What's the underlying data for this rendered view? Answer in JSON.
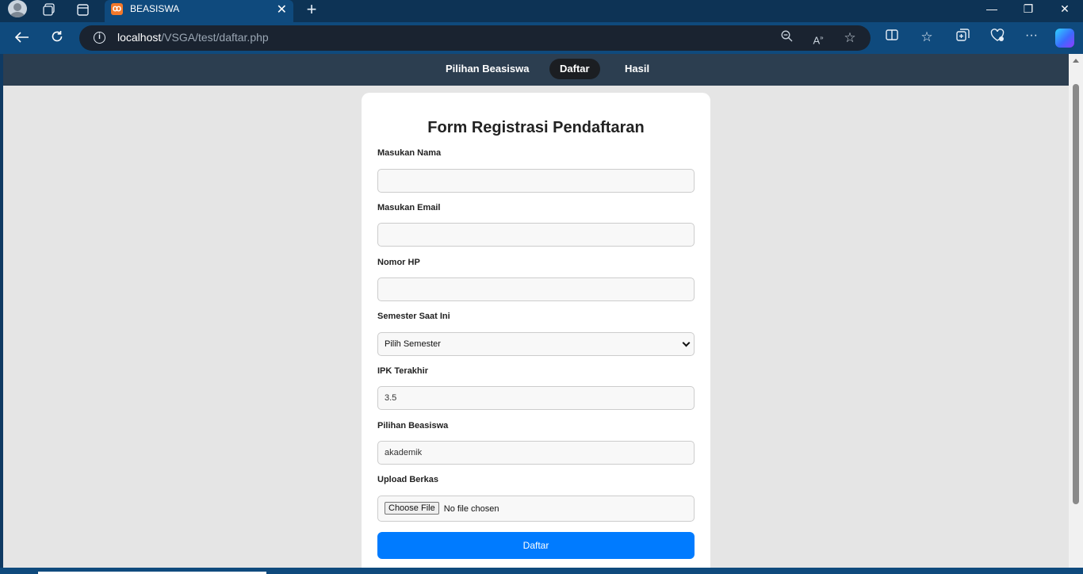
{
  "browser": {
    "tab_title": "BEASISWA",
    "favicon_letter": "ꝏ",
    "url_host": "localhost",
    "url_path": "/VSGA/test/daftar.php",
    "tab_close": "✕",
    "new_tab": "+",
    "minimize": "—",
    "restore": "❐",
    "close": "✕"
  },
  "nav": {
    "items": [
      {
        "label": "Pilihan Beasiswa"
      },
      {
        "label": "Daftar"
      },
      {
        "label": "Hasil"
      }
    ]
  },
  "form": {
    "title": "Form Registrasi Pendaftaran",
    "nama_label": "Masukan Nama",
    "nama_value": "",
    "email_label": "Masukan Email",
    "email_value": "",
    "hp_label": "Nomor HP",
    "hp_value": "",
    "semester_label": "Semester Saat Ini",
    "semester_value": "Pilih Semester",
    "ipk_label": "IPK Terakhir",
    "ipk_value": "3.5",
    "beasiswa_label": "Pilihan Beasiswa",
    "beasiswa_value": "akademik",
    "berkas_label": "Upload Berkas",
    "choose_file": "Choose File",
    "file_status": "No file chosen",
    "submit": "Daftar"
  }
}
